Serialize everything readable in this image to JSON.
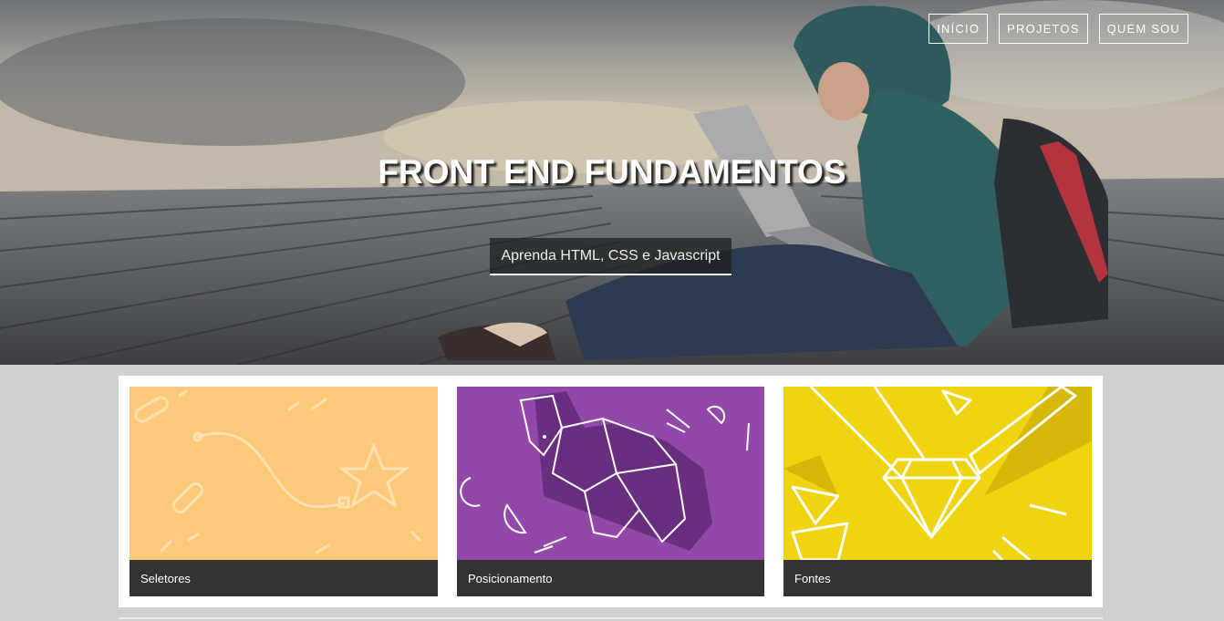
{
  "nav": {
    "items": [
      {
        "label": "INÍCIO"
      },
      {
        "label": "PROJETOS"
      },
      {
        "label": "QUEM SOU"
      }
    ]
  },
  "hero": {
    "title": "FRONT END FUNDAMENTOS",
    "subtitle": "Aprenda HTML, CSS e Javascript"
  },
  "cards": [
    {
      "label": "Seletores",
      "color": "#fec97a",
      "icon": "star-path-illustration"
    },
    {
      "label": "Posicionamento",
      "color": "#9148a9",
      "icon": "origami-elephant-illustration"
    },
    {
      "label": "Fontes",
      "color": "#f0d410",
      "icon": "diamond-pencil-illustration"
    }
  ]
}
